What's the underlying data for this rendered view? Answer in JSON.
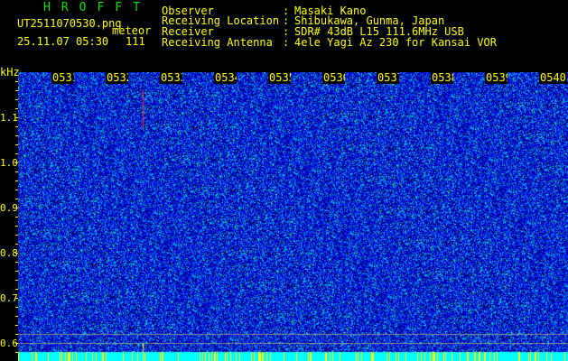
{
  "header": {
    "app_title": "HROFFT",
    "file_name": "UT2511070530.png",
    "mode": "meteor",
    "datetime": "25.11.07 05:30",
    "count": "111",
    "info": [
      {
        "label": "Observer",
        "value": "Masaki Kano"
      },
      {
        "label": "Receiving Location",
        "value": "Shibukawa, Gunma, Japan"
      },
      {
        "label": "Receiver",
        "value": "SDR# 43dB L15 111.6MHz USB"
      },
      {
        "label": "Receiving Antenna",
        "value": "4ele Yagi Az 230 for Kansai VOR"
      }
    ]
  },
  "axis": {
    "unit": "kHz",
    "y_ticks": [
      "1.1",
      "1.0",
      "0.9",
      "0.8",
      "0.7",
      "0.6"
    ],
    "x_ticks": [
      "0531",
      "0532",
      "0533",
      "0534",
      "0535",
      "0536",
      "0537",
      "0538",
      "0539",
      "0540"
    ]
  },
  "colors": {
    "background": "#000000",
    "text": "#ffff00",
    "title": "#00e000",
    "noise_low": "#0000a0",
    "noise_high": "#00ffff",
    "meteor": "#ff3030",
    "baseline": "#00ffff"
  }
}
